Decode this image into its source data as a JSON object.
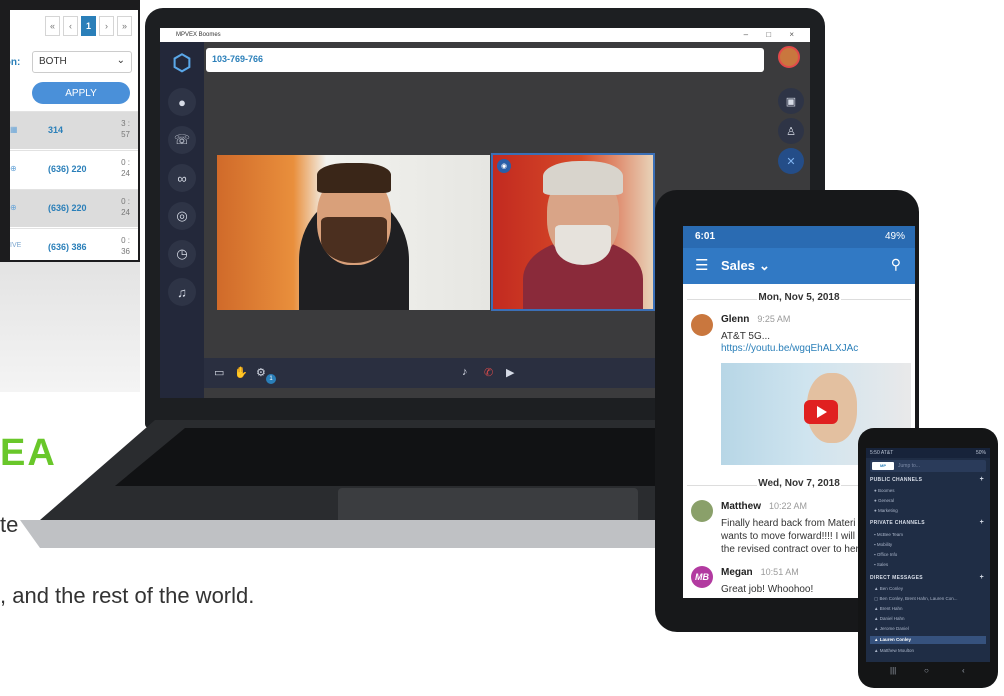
{
  "monitor": {
    "pager": [
      "«",
      "‹",
      "1",
      "›",
      "»"
    ],
    "direction_label": "ion:",
    "direction_value": "BOTH",
    "apply_label": "APPLY",
    "rows": [
      {
        "number": "314",
        "dur1": "3 :",
        "dur2": "57"
      },
      {
        "number": "(636) 220",
        "dur1": "0 :",
        "dur2": "24"
      },
      {
        "number": "(636) 220",
        "dur1": "0 :",
        "dur2": "24"
      },
      {
        "number": "(636) 386",
        "dur1": "0 :",
        "dur2": "36",
        "status": "IVE"
      }
    ]
  },
  "laptop": {
    "window_title": "MPVEX Boomes",
    "window_controls": "– □ ×",
    "call_number": "103-769-766"
  },
  "watermark": "EA",
  "tagline_top": "te",
  "tagline": ", and the rest of the world.",
  "tablet": {
    "time": "6:01",
    "battery": "49%",
    "channel": "Sales",
    "dates": [
      "Mon, Nov 5, 2018",
      "Wed, Nov 7, 2018"
    ],
    "messages": [
      {
        "name": "Glenn",
        "time": "9:25 AM",
        "lines": [
          "AT&T 5G..."
        ],
        "link": "https://youtu.be/wgqEhALXJAc"
      },
      {
        "name": "Matthew",
        "time": "10:22 AM",
        "lines": [
          "Finally heard back from Materi",
          "wants to move forward!!!! I will",
          "the revised contract over to her"
        ]
      },
      {
        "name": "Megan",
        "time": "10:51 AM",
        "initials": "MB",
        "lines": [
          "Great job!  Whoohoo!"
        ]
      }
    ]
  },
  "phone": {
    "time": "5:50 AT&T",
    "battery": "50%",
    "search_placeholder": "Jump to...",
    "logo": "MP",
    "sections": [
      {
        "title": "PUBLIC CHANNELS",
        "items": [
          "Boomes",
          "General",
          "Marketing"
        ]
      },
      {
        "title": "PRIVATE CHANNELS",
        "items": [
          "McBee Team",
          "Mobility",
          "Office Info",
          "Sales"
        ]
      },
      {
        "title": "DIRECT MESSAGES",
        "items": [
          "Ben Conley",
          "Ben Conley, Brent Hahn, Lauren Con...",
          "Brent Hahn",
          "Daniel Hahn",
          "Jerome Daniel",
          "Lauren Conley",
          "Matthew Moulton"
        ]
      }
    ]
  },
  "colors": {
    "accent": "#3179c4",
    "brand_green": "#69c72a",
    "rail": "#23283a"
  }
}
